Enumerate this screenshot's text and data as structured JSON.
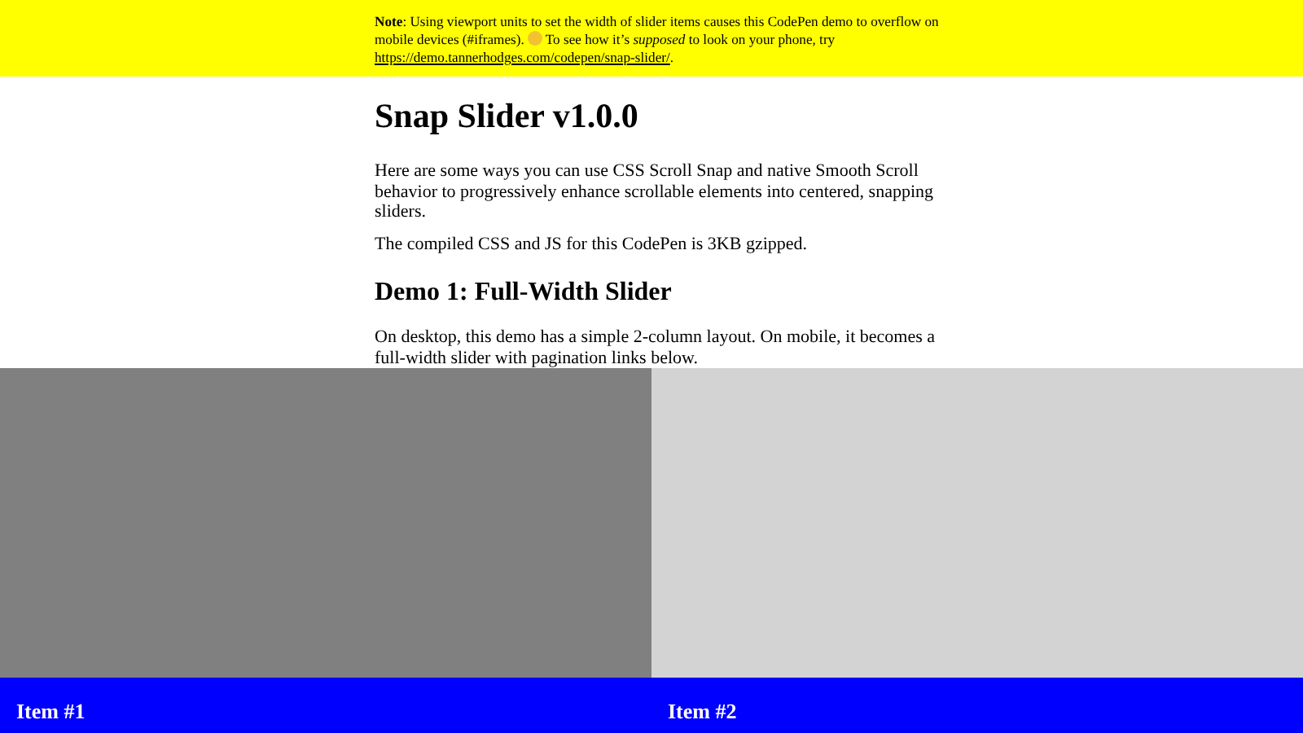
{
  "note": {
    "before": "**Note**: Using viewport units to set the width of slider items causes this CodePen demo to overflow on mobile devices (#iframes).",
    "after": "To see how it’s *supposed* to look on your phone, try",
    "link": "https://demo.tannerhodges.com/codepen/snap-slider/",
    "end": "."
  },
  "title": "Snap Slider v1.0.0",
  "paragraphs": [
    "Here are some ways you can use CSS Scroll Snap and native Smooth Scroll behavior to progressively enhance scrollable elements into centered, snapping sliders.",
    "The compiled CSS and JS for this CodePen is 3KB gzipped."
  ],
  "demo": {
    "heading": "Demo 1: Full-Width Slider",
    "text": "On desktop, this demo has a simple 2-column layout. On mobile, it becomes a full-width slider with pagination links below."
  },
  "slider_items": [
    {
      "label": "Item #1",
      "color": "#808080"
    },
    {
      "label": "Item #2",
      "color": "#d3d3d3"
    }
  ]
}
